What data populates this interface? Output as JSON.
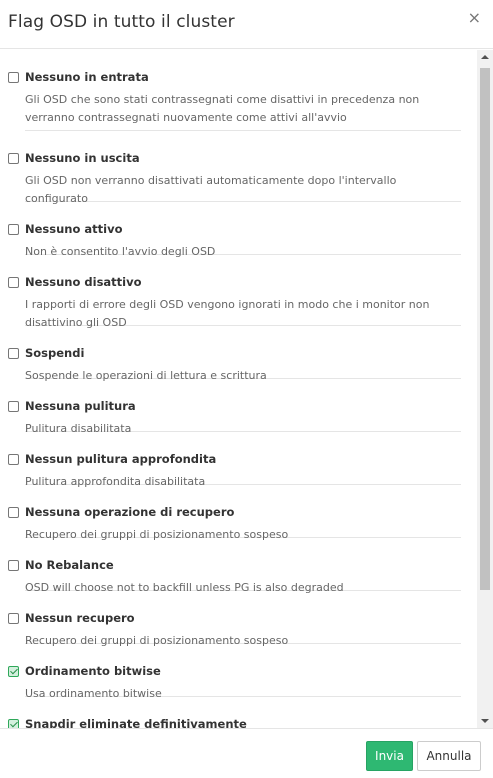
{
  "dialog": {
    "title": "Flag OSD in tutto il cluster",
    "close_glyph": "×"
  },
  "flags": [
    {
      "label": "Nessuno in entrata",
      "description": "Gli OSD che sono stati contrassegnati come disattivi in precedenza non verranno contrassegnati nuovamente come attivi all'avvio",
      "checked": false
    },
    {
      "label": "Nessuno in uscita",
      "description": "Gli OSD non verranno disattivati automaticamente dopo l'intervallo configurato",
      "checked": false
    },
    {
      "label": "Nessuno attivo",
      "description": "Non è consentito l'avvio degli OSD",
      "checked": false
    },
    {
      "label": "Nessuno disattivo",
      "description": "I rapporti di errore degli OSD vengono ignorati in modo che i monitor non disattivino gli OSD",
      "checked": false
    },
    {
      "label": "Sospendi",
      "description": "Sospende le operazioni di lettura e scrittura",
      "checked": false
    },
    {
      "label": "Nessuna pulitura",
      "description": "Pulitura disabilitata",
      "checked": false
    },
    {
      "label": "Nessun pulitura approfondita",
      "description": "Pulitura approfondita disabilitata",
      "checked": false
    },
    {
      "label": "Nessuna operazione di recupero",
      "description": "Recupero dei gruppi di posizionamento sospeso",
      "checked": false
    },
    {
      "label": "No Rebalance",
      "description": "OSD will choose not to backfill unless PG is also degraded",
      "checked": false
    },
    {
      "label": "Nessun recupero",
      "description": "Recupero dei gruppi di posizionamento sospeso",
      "checked": false
    },
    {
      "label": "Ordinamento bitwise",
      "description": "Usa ordinamento bitwise",
      "checked": true
    },
    {
      "label": "Snapdir eliminate definitivamente",
      "description": "",
      "checked": true
    }
  ],
  "footer": {
    "submit_label": "Invia",
    "cancel_label": "Annulla"
  },
  "colors": {
    "primary": "#2eb872",
    "checked": "#2fa85a"
  }
}
